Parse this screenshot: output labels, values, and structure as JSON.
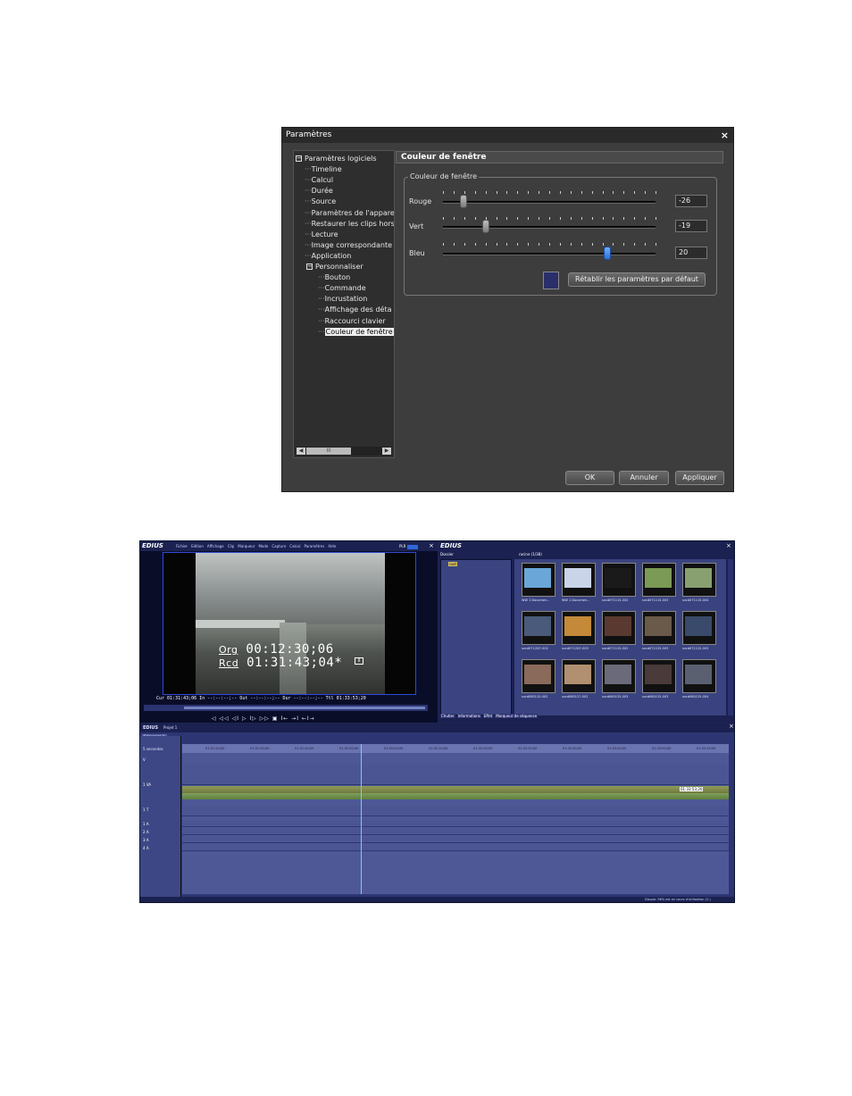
{
  "dialog": {
    "title": "Paramètres",
    "close": "×",
    "tree": [
      {
        "label": "Paramètres logiciels",
        "level": 0,
        "box": "−"
      },
      {
        "label": "Timeline",
        "level": 1
      },
      {
        "label": "Calcul",
        "level": 1
      },
      {
        "label": "Durée",
        "level": 1
      },
      {
        "label": "Source",
        "level": 1
      },
      {
        "label": "Paramètres de l'appare",
        "level": 1
      },
      {
        "label": "Restaurer les clips hors",
        "level": 1
      },
      {
        "label": "Lecture",
        "level": 1
      },
      {
        "label": "Image correspondante",
        "level": 1
      },
      {
        "label": "Application",
        "level": 1
      },
      {
        "label": "Personnaliser",
        "level": 1,
        "box": "−"
      },
      {
        "label": "Bouton",
        "level": 2
      },
      {
        "label": "Commande",
        "level": 2
      },
      {
        "label": "Incrustation",
        "level": 2
      },
      {
        "label": "Affichage des déta",
        "level": 2
      },
      {
        "label": "Raccourci clavier",
        "level": 2
      },
      {
        "label": "Couleur de fenêtre",
        "level": 2,
        "selected": true
      }
    ],
    "scroll": {
      "left": "◀",
      "thumb": "III",
      "right": "▶"
    },
    "panel_title": "Couleur de fenêtre",
    "group_title": "Couleur de fenêtre",
    "sliders": [
      {
        "label": "Rouge",
        "value": "-26",
        "fraction": 0.1,
        "color": "gray"
      },
      {
        "label": "Vert",
        "value": "-19",
        "fraction": 0.21,
        "color": "gray"
      },
      {
        "label": "Bleu",
        "value": "20",
        "fraction": 0.8,
        "color": "blue"
      }
    ],
    "swatch_color": "#2a2f6a",
    "reset_button": "Rétablir les paramètres par défaut",
    "ok": "OK",
    "cancel": "Annuler",
    "apply": "Appliquer"
  },
  "edius": {
    "logo": "EDIUS",
    "menu": [
      "Fichier",
      "Edition",
      "Affichage",
      "Clip",
      "Marqueur",
      "Mode",
      "Capture",
      "Calcul",
      "Paramètres",
      "Aide"
    ],
    "plr": "PLR",
    "timecode_org_label": "Org",
    "timecode_org": "00:12:30;06",
    "timecode_rcd_label": "Rcd",
    "timecode_rcd": "01:31:43;04*",
    "tc_line": "Cur 01:31:43;06   In --:--:--;--   Out --:--:--;--   Dur --:--:--;--   Ttl 01:33:53;20",
    "transport": "◁ ◁◁ ◁I ▷ I▷ ▷▷ ▣  I← →I ←I→",
    "bin_tabs": [
      "Chutier",
      "Informations",
      "Effet",
      "Marqueur de séquence"
    ],
    "bin_folder": "Dossier",
    "bin_root": "root",
    "bin_path": "racine (1/38)",
    "clips": [
      {
        "cap": "WW 1 Documen...",
        "color": "#6aa6d8"
      },
      {
        "cap": "WW 1 Documen...",
        "color": "#c9d4e8"
      },
      {
        "cap": "svcd071115-002",
        "color": "#1a1a1a"
      },
      {
        "cap": "svcd071115-003",
        "color": "#7a9a55"
      },
      {
        "cap": "svcd071115-004",
        "color": "#88a070"
      },
      {
        "cap": "svcd0712D7-002",
        "color": "#4a5a7a"
      },
      {
        "cap": "svcd0712D7-003",
        "color": "#c48a3a"
      },
      {
        "cap": "svcd071125-002",
        "color": "#5a3a30"
      },
      {
        "cap": "svcd071125-003",
        "color": "#6a5a4a"
      },
      {
        "cap": "svcd071122-003",
        "color": "#3a4a6a"
      },
      {
        "cap": "svcd080115-002",
        "color": "#8a6a5a"
      },
      {
        "cap": "svcd080127-002",
        "color": "#b09070"
      },
      {
        "cap": "svcd080125-003",
        "color": "#6a6a7a"
      },
      {
        "cap": "svcd080125-003",
        "color": "#4a3a3a"
      },
      {
        "cap": "svcd080125-004",
        "color": "#5a6070"
      }
    ],
    "timeline_title": "EDIUS",
    "project": "Projet 1",
    "sequence": "Séquence 1",
    "scale": "5 secondes",
    "ruler_ticks": [
      "01:31:20;00",
      "01:31:30;00",
      "01:31:40;00",
      "01:31:50;00",
      "01:32:00;00",
      "01:32:10;00",
      "01:32:20;00",
      "01:32:30;00",
      "01:32:40;00",
      "01:32:50;00",
      "01:33:00;00",
      "01:33:10;00"
    ],
    "tracks": [
      "V",
      "1 VA",
      "1 T",
      "1 A",
      "2 A",
      "3 A",
      "4 A"
    ],
    "clip_end_label": "01:33:53;20",
    "status": "Disque: 96% est en cours d'utilisation (C:)"
  }
}
